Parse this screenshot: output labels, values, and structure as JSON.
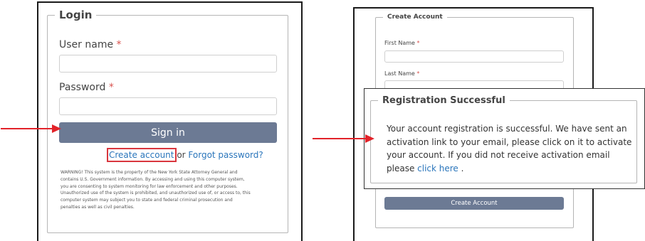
{
  "login": {
    "legend": "Login",
    "username_label": "User name",
    "password_label": "Password",
    "required_mark": "*",
    "signin_label": "Sign in",
    "create_account_link": "Create account",
    "or_text": " or ",
    "forgot_password_link": "Forgot password?",
    "warning_text": "WARNING! This system is the property of the New York State Attorney General and\ncontains U.S. Government information. By accessing and using this computer system,\nyou are consenting to system monitoring for law enforcement and other purposes.\nUnauthorized use of the system is prohibited, and unauthorized use of, or access to, this\ncomputer system may subject you to state and federal criminal prosecution and\npenalties as well as civil penalties."
  },
  "create_account": {
    "legend": "Create Account",
    "first_name_label": "First Name",
    "last_name_label": "Last Name",
    "submit_label": "Create Account"
  },
  "registration": {
    "legend": "Registration Successful",
    "message": "Your account registration is successful. We have sent an activation link to your email, please click on it to activate your account. If you did not receive activation email please ",
    "click_here_link": "click here",
    "message_end": " ."
  },
  "colors": {
    "button": "#6c7a94",
    "link": "#2a75bb",
    "arrow": "#e2232a",
    "required": "#d9534f"
  }
}
